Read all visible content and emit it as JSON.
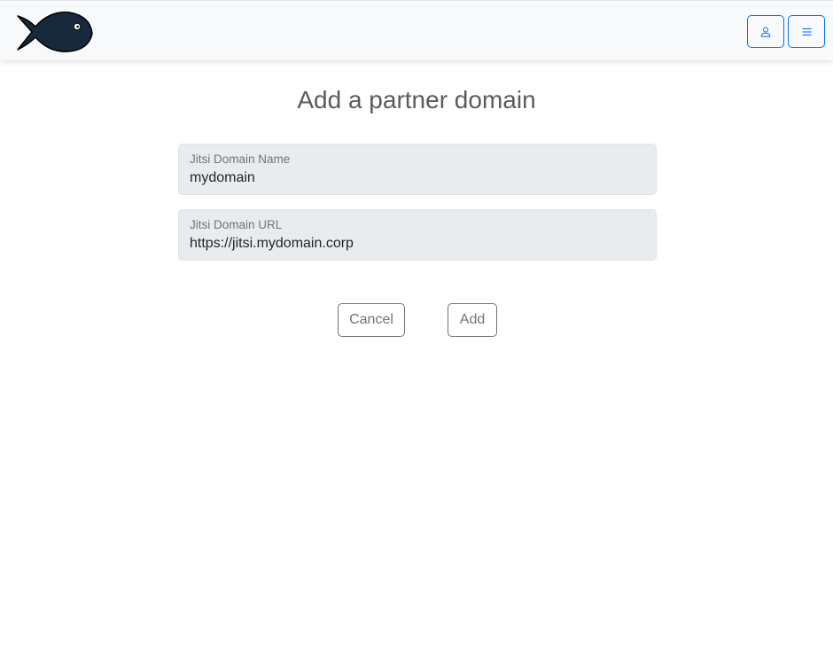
{
  "header": {
    "logo_icon": "fish-logo-icon",
    "user_button_icon": "person-icon",
    "menu_button_icon": "hamburger-menu-icon",
    "accent_color": "#0d6efd"
  },
  "page": {
    "title": "Add a partner domain"
  },
  "form": {
    "domain_name": {
      "label": "Jitsi Domain Name",
      "value": "mydomain"
    },
    "domain_url": {
      "label": "Jitsi Domain URL",
      "value": "https://jitsi.mydomain.corp"
    },
    "cancel_label": "Cancel",
    "add_label": "Add"
  }
}
